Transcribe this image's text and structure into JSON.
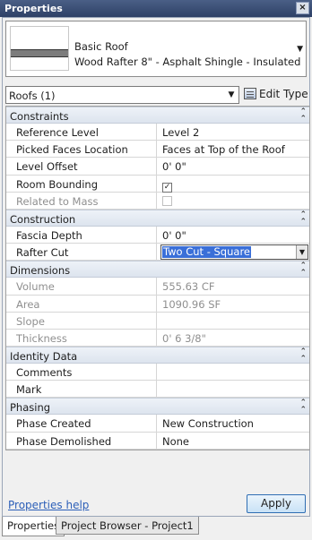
{
  "window": {
    "title": "Properties",
    "close_glyph": "×"
  },
  "type_selector": {
    "family": "Basic Roof",
    "type": "Wood Rafter 8\" - Asphalt Shingle - Insulated",
    "dropdown_icon": "chevron-down-icon"
  },
  "filter": {
    "value": "Roofs (1)",
    "edit_type_label": "Edit Type"
  },
  "groups": {
    "constraints": "Constraints",
    "construction": "Construction",
    "dimensions": "Dimensions",
    "identity": "Identity Data",
    "phasing": "Phasing"
  },
  "constraints": {
    "reference_level": {
      "label": "Reference Level",
      "value": "Level 2"
    },
    "picked_faces": {
      "label": "Picked Faces Location",
      "value": "Faces at Top of the Roof"
    },
    "level_offset": {
      "label": "Level Offset",
      "value": "0'  0\""
    },
    "room_bounding": {
      "label": "Room Bounding",
      "checked": true,
      "glyph": "✓"
    },
    "related_to_mass": {
      "label": "Related to Mass",
      "checked": false
    }
  },
  "construction": {
    "fascia_depth": {
      "label": "Fascia Depth",
      "value": "0'  0\""
    },
    "rafter_cut": {
      "label": "Rafter Cut",
      "value": "Two Cut - Square"
    }
  },
  "dimensions": {
    "volume": {
      "label": "Volume",
      "value": "555.63 CF"
    },
    "area": {
      "label": "Area",
      "value": "1090.96 SF"
    },
    "slope": {
      "label": "Slope",
      "value": ""
    },
    "thickness": {
      "label": "Thickness",
      "value": "0'  6 3/8\""
    }
  },
  "identity": {
    "comments": {
      "label": "Comments",
      "value": ""
    },
    "mark": {
      "label": "Mark",
      "value": ""
    }
  },
  "phasing": {
    "phase_created": {
      "label": "Phase Created",
      "value": "New Construction"
    },
    "phase_demolished": {
      "label": "Phase Demolished",
      "value": "None"
    }
  },
  "footer": {
    "help_link": "Properties help",
    "apply_label": "Apply"
  },
  "tabs": {
    "properties": "Properties",
    "project_browser": "Project Browser - Project1"
  },
  "colors": {
    "title_bar": "#3a4d74",
    "selection": "#3a6fd8",
    "link": "#2c5fb8"
  }
}
